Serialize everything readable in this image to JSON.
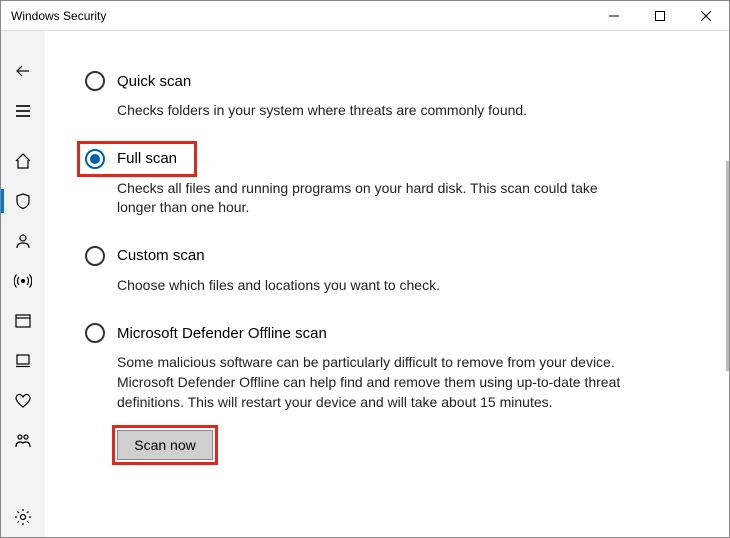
{
  "window": {
    "title": "Windows Security"
  },
  "options": {
    "quick": {
      "label": "Quick scan",
      "desc": "Checks folders in your system where threats are commonly found."
    },
    "full": {
      "label": "Full scan",
      "desc": "Checks all files and running programs on your hard disk. This scan could take longer than one hour."
    },
    "custom": {
      "label": "Custom scan",
      "desc": "Choose which files and locations you want to check."
    },
    "offline": {
      "label": "Microsoft Defender Offline scan",
      "desc": "Some malicious software can be particularly difficult to remove from your device. Microsoft Defender Offline can help find and remove them using up-to-date threat definitions. This will restart your device and will take about 15 minutes."
    }
  },
  "selected_option": "full",
  "actions": {
    "scan_now": "Scan now"
  }
}
